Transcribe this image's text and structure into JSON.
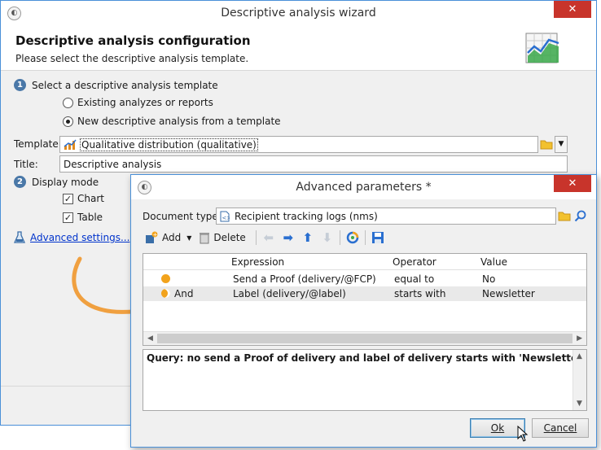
{
  "main_window": {
    "title": "Descriptive analysis wizard",
    "close_glyph": "✕",
    "header": {
      "title": "Descriptive analysis configuration",
      "subtitle": "Please select the descriptive analysis template."
    },
    "step1": {
      "number": "1",
      "label": "Select a descriptive analysis template",
      "options": [
        {
          "label": "Existing analyzes or reports",
          "selected": false
        },
        {
          "label": "New descriptive analysis from a template",
          "selected": true
        }
      ]
    },
    "template": {
      "label": "Template:",
      "value": "Qualitative distribution (qualitative)"
    },
    "title_field": {
      "label": "Title:",
      "value": "Descriptive analysis"
    },
    "step2": {
      "number": "2",
      "label": "Display mode",
      "checks": [
        {
          "label": "Chart",
          "checked": true
        },
        {
          "label": "Table",
          "checked": true
        }
      ]
    },
    "advanced_link": "Advanced settings..."
  },
  "dialog": {
    "title": "Advanced parameters *",
    "close_glyph": "✕",
    "document_type": {
      "label": "Document type:",
      "value": "Recipient tracking logs (nms)"
    },
    "toolbar": {
      "add_label": "Add",
      "delete_label": "Delete"
    },
    "grid": {
      "columns": [
        "Expression",
        "Operator",
        "Value"
      ],
      "rows": [
        {
          "logic": "",
          "expression": "Send a Proof (delivery/@FCP)",
          "operator": "equal to",
          "value": "No"
        },
        {
          "logic": "And",
          "expression": "Label (delivery/@label)",
          "operator": "starts with",
          "value": "Newsletter"
        }
      ]
    },
    "query_text": "Query: no send a Proof of delivery and label of delivery starts with 'Newsletter'",
    "ok_label": "Ok",
    "cancel_label": "Cancel"
  },
  "colors": {
    "accent_blue": "#4a90d8",
    "close_red": "#c8342b",
    "arrow_orange": "#f0a040",
    "condition_dot": "#f2a31c"
  }
}
